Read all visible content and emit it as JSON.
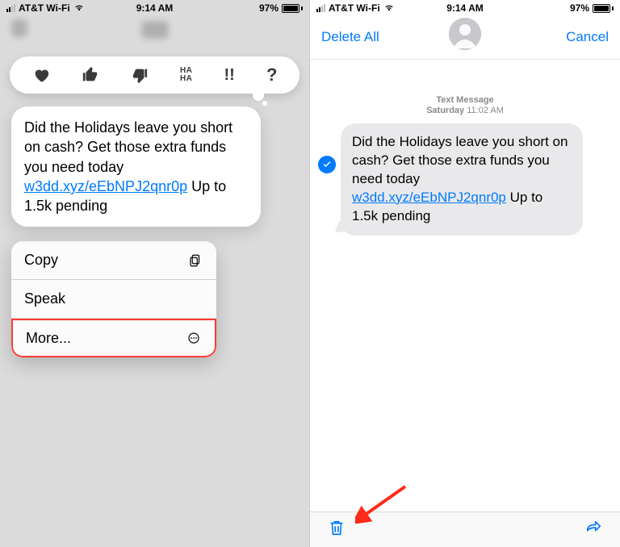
{
  "statusbar": {
    "carrier": "AT&T Wi-Fi",
    "time": "9:14 AM",
    "battery": "97%"
  },
  "reactions": {
    "heart": "heart",
    "thumbsup": "thumbs-up",
    "thumbsdown": "thumbs-down",
    "haha": "HA HA",
    "bangbang": "!!",
    "question": "?"
  },
  "message": {
    "text_pre": "Did the Holidays leave you short on cash? Get those extra funds you need today ",
    "link": "w3dd.xyz/eEbNPJ2qnr0p",
    "text_post": " Up to 1.5k pending"
  },
  "action_sheet": {
    "copy": "Copy",
    "speak": "Speak",
    "more": "More..."
  },
  "right": {
    "delete_all": "Delete All",
    "cancel": "Cancel",
    "meta1": "Text Message",
    "meta2_day": "Saturday",
    "meta2_time": "11:02 AM"
  }
}
